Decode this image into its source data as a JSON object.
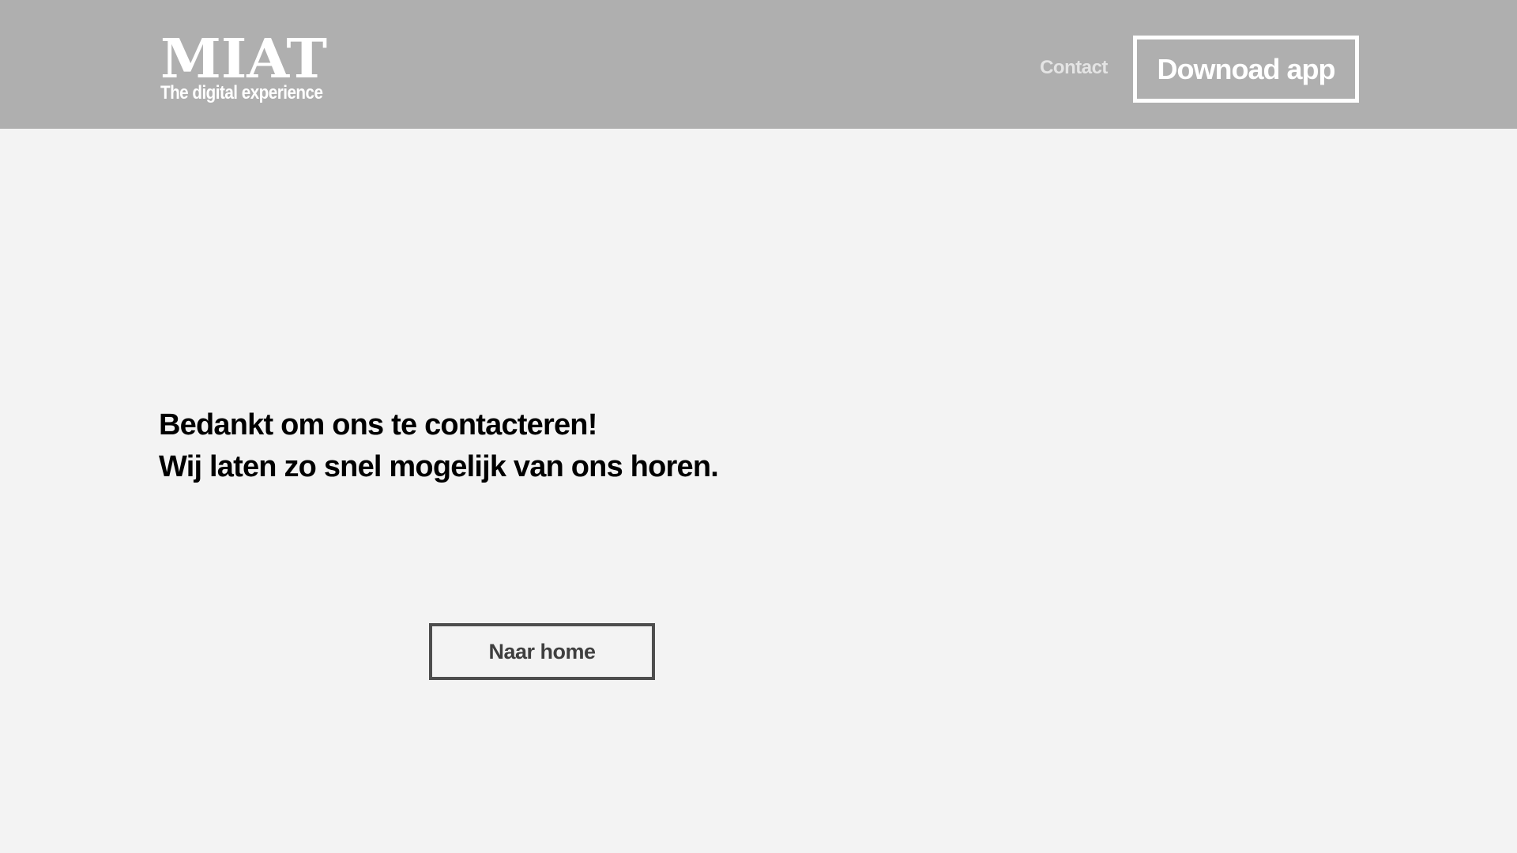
{
  "header": {
    "logo_title": "MIAT",
    "logo_tagline": "The digital experience",
    "nav_contact_label": "Contact",
    "download_button_label": "Downoad app"
  },
  "main": {
    "message_line_1": "Bedankt om ons te contacteren!",
    "message_line_2": "Wij laten zo snel mogelijk van ons horen.",
    "home_button_label": "Naar home"
  },
  "colors": {
    "header_background": "#afafaf",
    "page_background": "#f3f3f3",
    "header_text": "#ffffff",
    "nav_link_text": "#e4e4e4",
    "body_text": "#000000",
    "home_button_border": "#4d4d4d"
  }
}
